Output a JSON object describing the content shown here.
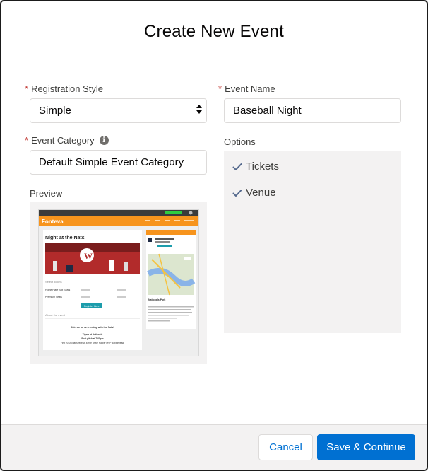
{
  "modal": {
    "title": "Create New Event"
  },
  "form": {
    "required_marker": "*",
    "registration_style": {
      "label": "Registration Style",
      "value": "Simple"
    },
    "event_name": {
      "label": "Event Name",
      "value": "Baseball Night"
    },
    "event_category": {
      "label": "Event Category",
      "value": "Default Simple Event Category",
      "info_icon": "info-icon"
    },
    "options": {
      "label": "Options",
      "items": [
        "Tickets",
        "Venue"
      ]
    },
    "preview": {
      "label": "Preview",
      "thumbnail": {
        "brand": "Fonteva",
        "event_title": "Night at the Nats",
        "select_tickets": "Select tickets",
        "tickets": [
          "Home Plate Box Seats",
          "Premium Seats"
        ],
        "register_button": "Register Here",
        "about_heading": "About the event",
        "about_lines": [
          "Join us for an evening with the Nats!",
          "Tigers at Nationals",
          "First pitch at 7:05pm",
          "First 20,000 fans receive a free Bryce Harper MVP Bobblehead!"
        ],
        "venue_heading": "Nationals Park"
      }
    }
  },
  "footer": {
    "cancel_label": "Cancel",
    "save_label": "Save & Continue"
  },
  "colors": {
    "brand_blue": "#0070d2",
    "required_red": "#c23934",
    "thumb_orange": "#f7941d"
  }
}
